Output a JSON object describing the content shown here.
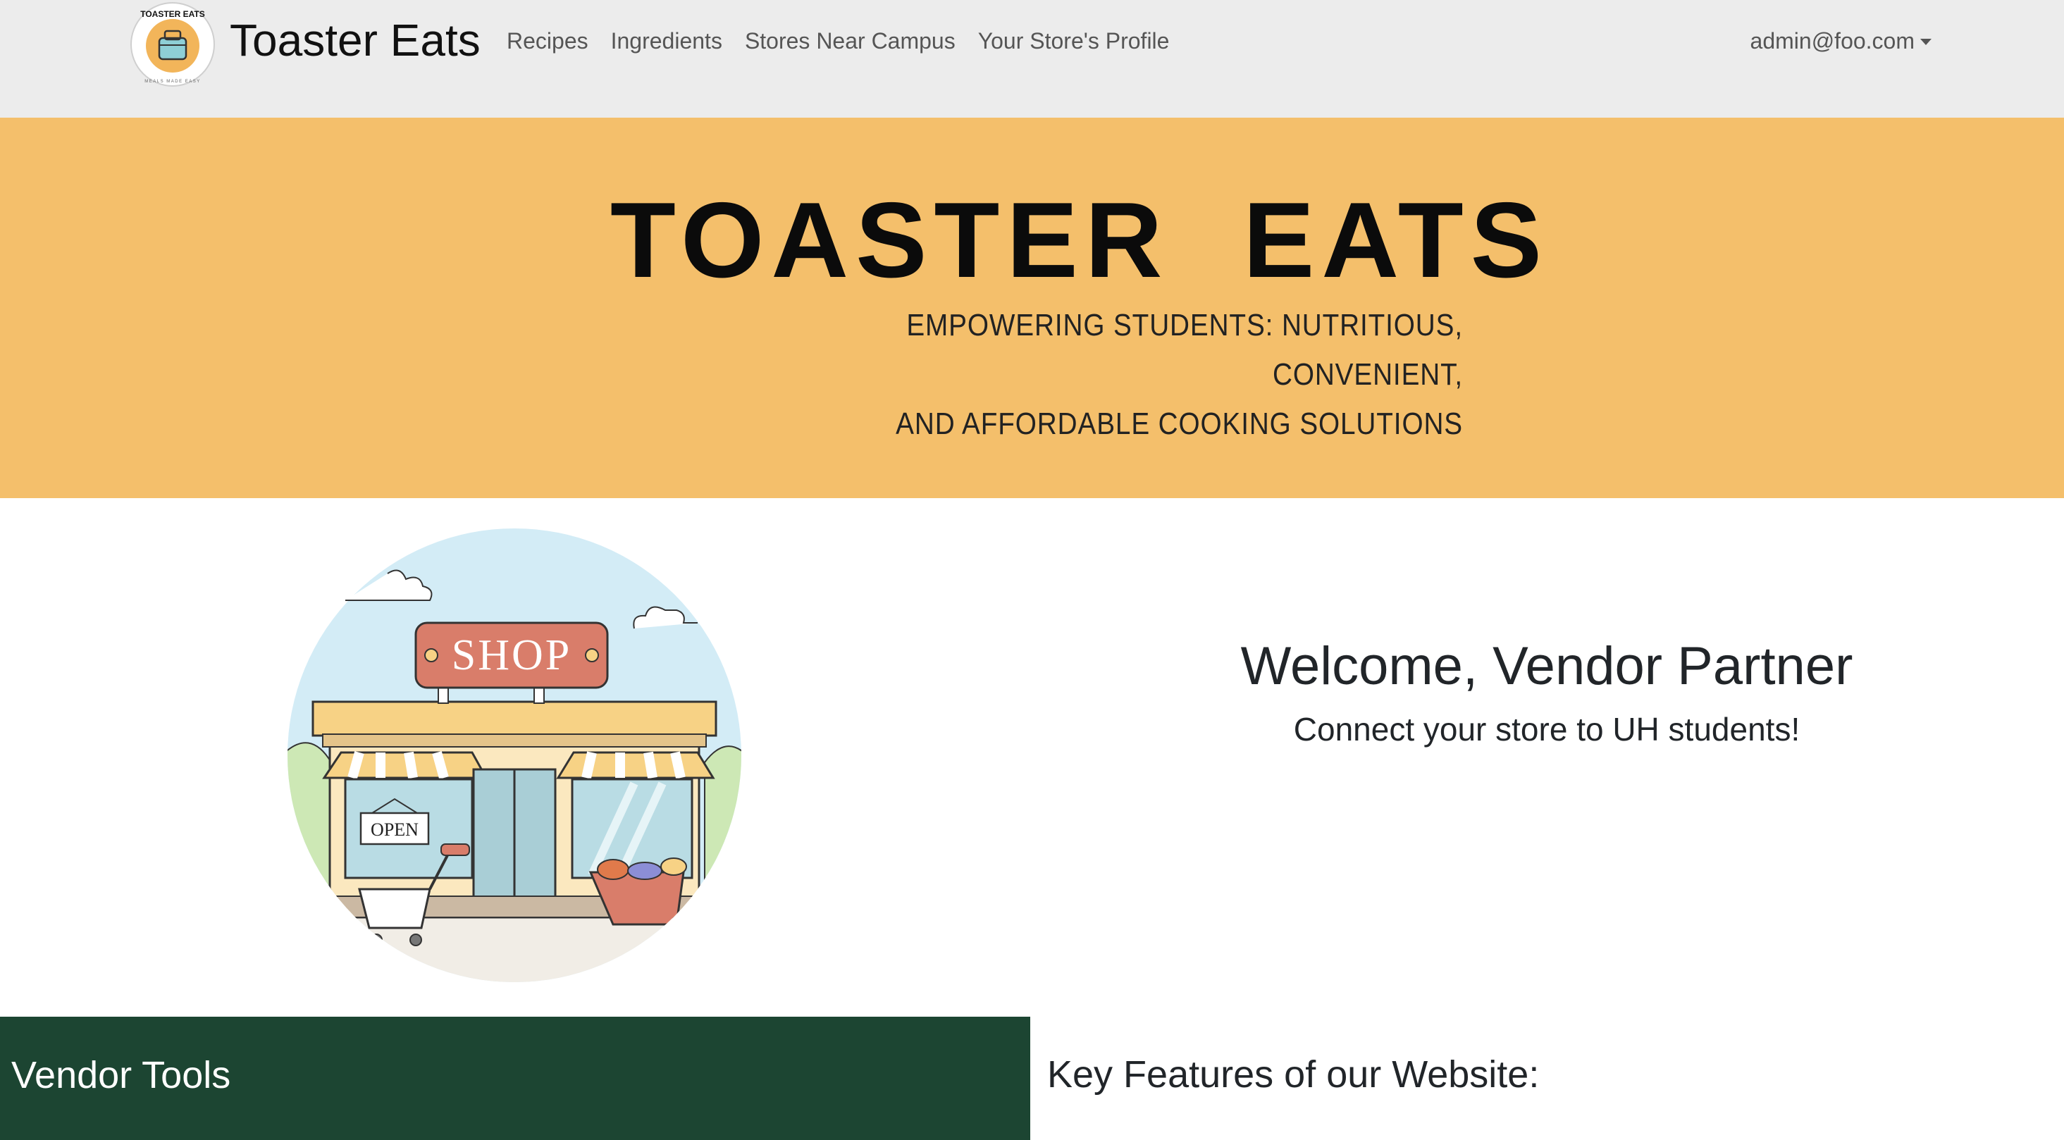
{
  "navbar": {
    "logo_text": "TOASTER EATS",
    "logo_tagline": "MEALS MADE EASY",
    "brand": "Toaster Eats",
    "links": [
      "Recipes",
      "Ingredients",
      "Stores Near Campus",
      "Your Store's Profile"
    ],
    "user": "admin@foo.com"
  },
  "hero": {
    "title": "TOASTER  EATS",
    "subtitle_line1": "EMPOWERING STUDENTS: NUTRITIOUS, CONVENIENT,",
    "subtitle_line2": "AND AFFORDABLE COOKING SOLUTIONS",
    "background_color": "#f4bf6b"
  },
  "illustration": {
    "sign_text": "SHOP",
    "open_sign_text": "OPEN"
  },
  "welcome": {
    "title": "Welcome, Vendor Partner",
    "subtitle": "Connect your store to UH students!"
  },
  "vendor_tools": {
    "title": "Vendor Tools",
    "background_color": "#1c4532"
  },
  "features": {
    "title": "Key Features of our Website:"
  }
}
